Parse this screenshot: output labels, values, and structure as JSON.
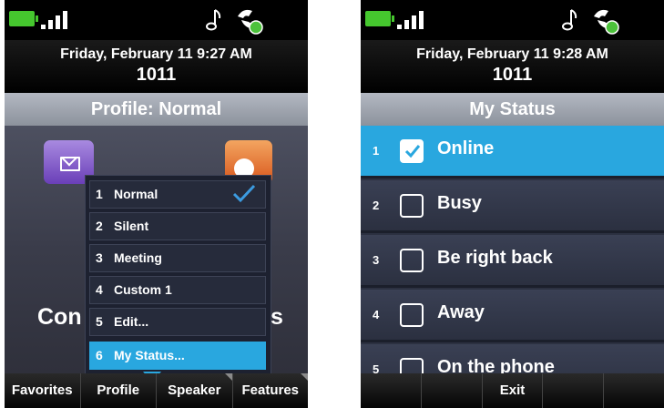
{
  "left": {
    "date": "Friday, February 11 9:27 AM",
    "extension": "1011",
    "title": "Profile: Normal",
    "background_text_left": "Con",
    "background_text_right": "s",
    "menu": [
      {
        "num": "1",
        "label": "Normal",
        "checked": true
      },
      {
        "num": "2",
        "label": "Silent"
      },
      {
        "num": "3",
        "label": "Meeting"
      },
      {
        "num": "4",
        "label": "Custom 1"
      },
      {
        "num": "5",
        "label": "Edit..."
      },
      {
        "num": "6",
        "label": "My Status...",
        "selected": true
      }
    ],
    "softkeys": [
      "Favorites",
      "Profile",
      "Speaker",
      "Features"
    ]
  },
  "right": {
    "date": "Friday, February 11 9:28 AM",
    "extension": "1011",
    "title": "My Status",
    "statuses": [
      {
        "num": "1",
        "label": "Online",
        "checked": true
      },
      {
        "num": "2",
        "label": "Busy"
      },
      {
        "num": "3",
        "label": "Be right back"
      },
      {
        "num": "4",
        "label": "Away"
      },
      {
        "num": "5",
        "label": "On the phone"
      }
    ],
    "softkeys": [
      "",
      "",
      "Exit",
      "",
      ""
    ]
  },
  "icons": {
    "battery": "battery-icon",
    "signal": "signal-strength-icon",
    "ringer": "music-note-icon",
    "handset": "handset-icon",
    "messages": "envelope-icon",
    "settings": "gear-icon",
    "check": "check-icon"
  },
  "colors": {
    "accent": "#29a7df",
    "battery": "#45c72e",
    "titlebar": "#a0a6b0",
    "messages_app": "#7b52c7",
    "settings_app": "#e56f2c"
  }
}
